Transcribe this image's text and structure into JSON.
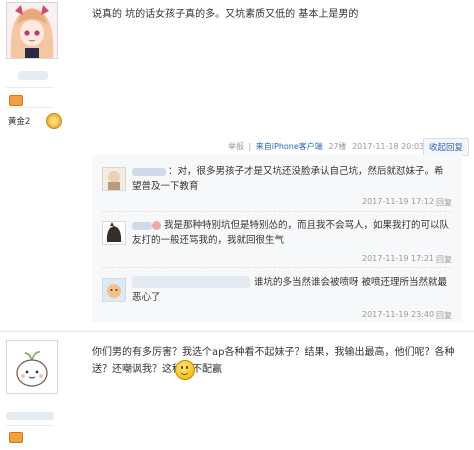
{
  "post1": {
    "text": "说真的 坑的话女孩子真的多。又坑素质又低的 基本上是男的",
    "rank_label": "黄金2",
    "meta": {
      "report": "举报",
      "source": "来自iPhone客户端",
      "floor": "27楼",
      "time": "2017-11-18 20:03",
      "collapse": "收起回复"
    },
    "replies": [
      {
        "text": "：对，很多男孩子才是又坑还没脸承认自己坑，然后就怼妹子。希望普及一下教育",
        "time": "2017-11-19 17:12",
        "action": "回复"
      },
      {
        "text": "我是那种特别坑但是特别怂的，而且我不会骂人，如果我打的可以队友打的一般还骂我的，我就回很生气",
        "time": "2017-11-19 17:21",
        "action": "回复"
      },
      {
        "text": "谁坑的多当然谁会被喷呀 被喷还理所当然就最恶心了",
        "time": "2017-11-19 23:40",
        "action": "回复"
      }
    ]
  },
  "post2": {
    "text": "你们男的有多厉害？我选个ap各种看不起妹子？结果，我输出最高，他们呢？各种送？还嘲讽我？这种**不配赢"
  },
  "colors": {
    "link": "#2d64b3",
    "meta_gray": "#999999",
    "reply_bg": "#f7f8fa",
    "badge_orange": "#f0a040"
  }
}
